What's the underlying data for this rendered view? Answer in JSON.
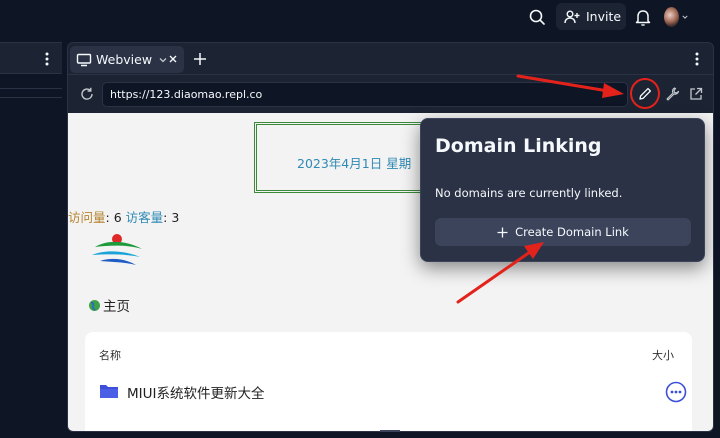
{
  "topbar": {
    "invite_label": "Invite",
    "icons": [
      "search-icon",
      "person-add-icon",
      "bell-icon",
      "avatar",
      "chevron-down-icon"
    ]
  },
  "panel": {
    "tab_label": "Webview",
    "url": "https://123.diaomao.repl.co",
    "icons": [
      "monitor-icon",
      "chevron-down-icon",
      "close-icon",
      "plus-icon",
      "kebab-icon",
      "reload-icon",
      "pencil-icon",
      "wrench-icon",
      "external-link-icon"
    ]
  },
  "webview": {
    "date_text": "2023年4月1日 星期",
    "visits_label": "访问量",
    "visits_value": ": 6",
    "visitors_label": "访客量",
    "visitors_value": ": 3",
    "home_label": "主页",
    "table": {
      "col_name": "名称",
      "col_size": "大小",
      "rows": [
        {
          "label": "MIUI系统软件更新大全"
        }
      ]
    }
  },
  "popup": {
    "title": "Domain Linking",
    "message": "No domains are currently linked.",
    "button_label": "Create Domain Link"
  },
  "colors": {
    "app_bg": "#0e1525",
    "panel_bg": "#1c2333",
    "popup_bg": "#2b3245",
    "annotation_red": "#e3231b",
    "folder_blue": "#3b4fd8"
  }
}
